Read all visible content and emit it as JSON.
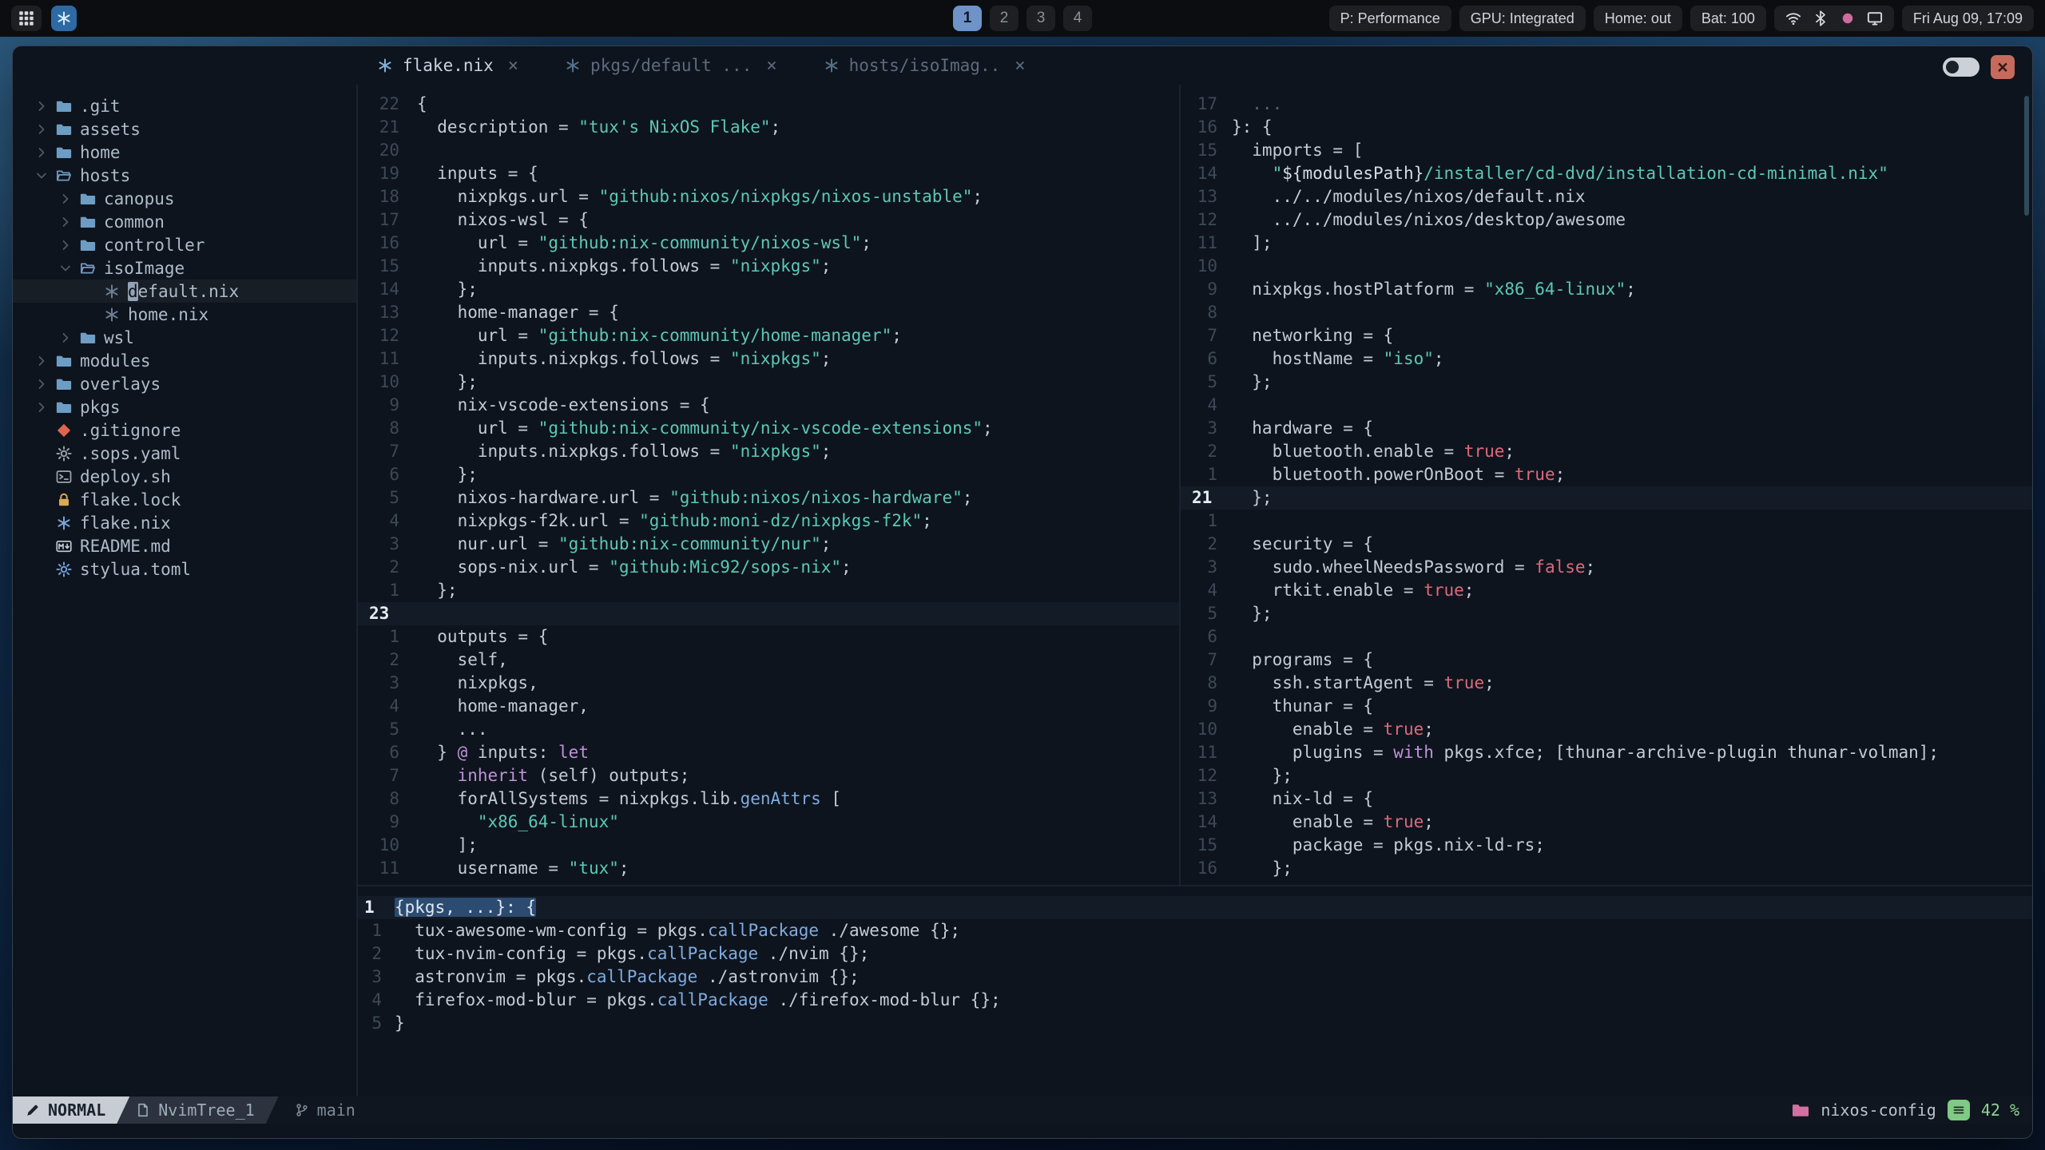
{
  "topbar": {
    "workspaces": [
      "1",
      "2",
      "3",
      "4"
    ],
    "active_workspace": "1",
    "status_chips": [
      "P: Performance",
      "GPU: Integrated",
      "Home: out",
      "Bat: 100"
    ],
    "tray_icons": [
      {
        "icon": "wifi-icon",
        "color": "#d6d9de"
      },
      {
        "icon": "bluetooth-icon",
        "color": "#d6d9de"
      },
      {
        "icon": "record-icon",
        "color": "#d06ba0"
      },
      {
        "icon": "display-icon",
        "color": "#d6d9de"
      }
    ],
    "clock": "Fri Aug 09, 17:09"
  },
  "window": {
    "tab_close_glyph": "×",
    "close_glyph": "×",
    "tabs": [
      {
        "label": "flake.nix",
        "active": true
      },
      {
        "label": "pkgs/default ...",
        "active": false
      },
      {
        "label": "hosts/isoImag..",
        "active": false
      }
    ]
  },
  "filetree": {
    "items": [
      {
        "depth": 0,
        "chevron": "right",
        "icon": "folder-icon",
        "color": "#6d9dc5",
        "label": ".git"
      },
      {
        "depth": 0,
        "chevron": "right",
        "icon": "folder-icon",
        "color": "#6d9dc5",
        "label": "assets"
      },
      {
        "depth": 0,
        "chevron": "right",
        "icon": "folder-icon",
        "color": "#6d9dc5",
        "label": "home"
      },
      {
        "depth": 0,
        "chevron": "down",
        "icon": "folder-open-icon",
        "color": "#6d9dc5",
        "label": "hosts"
      },
      {
        "depth": 1,
        "chevron": "right",
        "icon": "folder-icon",
        "color": "#6d9dc5",
        "label": "canopus"
      },
      {
        "depth": 1,
        "chevron": "right",
        "icon": "folder-icon",
        "color": "#6d9dc5",
        "label": "common"
      },
      {
        "depth": 1,
        "chevron": "right",
        "icon": "folder-icon",
        "color": "#6d9dc5",
        "label": "controller"
      },
      {
        "depth": 1,
        "chevron": "down",
        "icon": "folder-open-icon",
        "color": "#6d9dc5",
        "label": "isoImage"
      },
      {
        "depth": 2,
        "icon": "nix-icon",
        "color": "#6b7d92",
        "label": "default.nix",
        "cursor": true
      },
      {
        "depth": 2,
        "icon": "nix-icon",
        "color": "#6b7d92",
        "label": "home.nix"
      },
      {
        "depth": 1,
        "chevron": "right",
        "icon": "folder-icon",
        "color": "#6d9dc5",
        "label": "wsl"
      },
      {
        "depth": 0,
        "chevron": "right",
        "icon": "folder-icon",
        "color": "#6d9dc5",
        "label": "modules"
      },
      {
        "depth": 0,
        "chevron": "right",
        "icon": "folder-icon",
        "color": "#6d9dc5",
        "label": "overlays"
      },
      {
        "depth": 0,
        "chevron": "right",
        "icon": "folder-icon",
        "color": "#6d9dc5",
        "label": "pkgs"
      },
      {
        "depth": 0,
        "icon": "git-icon",
        "color": "#e0654f",
        "label": ".gitignore"
      },
      {
        "depth": 0,
        "icon": "gear-icon",
        "color": "#96a0ab",
        "label": ".sops.yaml"
      },
      {
        "depth": 0,
        "icon": "terminal-icon",
        "color": "#9aa5af",
        "label": "deploy.sh"
      },
      {
        "depth": 0,
        "icon": "lock-icon",
        "color": "#d9a954",
        "label": "flake.lock"
      },
      {
        "depth": 0,
        "icon": "nix-icon",
        "color": "#7aa7d4",
        "label": "flake.nix"
      },
      {
        "depth": 0,
        "icon": "markdown-icon",
        "color": "#c6cdd6",
        "label": "README.md"
      },
      {
        "depth": 0,
        "icon": "gear-icon",
        "color": "#6f9fd8",
        "label": "stylua.toml"
      }
    ]
  },
  "editors": {
    "flake": {
      "lines": [
        {
          "n": "22",
          "t": [
            [
              "p",
              "{"
            ]
          ]
        },
        {
          "n": "21",
          "t": [
            [
              "p",
              "  description = "
            ],
            [
              "s",
              "\"tux's NixOS Flake\""
            ],
            [
              "p",
              ";"
            ]
          ]
        },
        {
          "n": "20",
          "t": []
        },
        {
          "n": "19",
          "t": [
            [
              "p",
              "  inputs = {"
            ]
          ]
        },
        {
          "n": "18",
          "t": [
            [
              "p",
              "    nixpkgs.url = "
            ],
            [
              "s",
              "\"github:nixos/nixpkgs/nixos-unstable\""
            ],
            [
              "p",
              ";"
            ]
          ]
        },
        {
          "n": "17",
          "t": [
            [
              "p",
              "    nixos-wsl = {"
            ]
          ]
        },
        {
          "n": "16",
          "t": [
            [
              "p",
              "      url = "
            ],
            [
              "s",
              "\"github:nix-community/nixos-wsl\""
            ],
            [
              "p",
              ";"
            ]
          ]
        },
        {
          "n": "15",
          "t": [
            [
              "p",
              "      inputs.nixpkgs.follows = "
            ],
            [
              "s",
              "\"nixpkgs\""
            ],
            [
              "p",
              ";"
            ]
          ]
        },
        {
          "n": "14",
          "t": [
            [
              "p",
              "    };"
            ]
          ]
        },
        {
          "n": "13",
          "t": [
            [
              "p",
              "    home-manager = {"
            ]
          ]
        },
        {
          "n": "12",
          "t": [
            [
              "p",
              "      url = "
            ],
            [
              "s",
              "\"github:nix-community/home-manager\""
            ],
            [
              "p",
              ";"
            ]
          ]
        },
        {
          "n": "11",
          "t": [
            [
              "p",
              "      inputs.nixpkgs.follows = "
            ],
            [
              "s",
              "\"nixpkgs\""
            ],
            [
              "p",
              ";"
            ]
          ]
        },
        {
          "n": "10",
          "t": [
            [
              "p",
              "    };"
            ]
          ]
        },
        {
          "n": "9",
          "t": [
            [
              "p",
              "    nix-vscode-extensions = {"
            ]
          ]
        },
        {
          "n": "8",
          "t": [
            [
              "p",
              "      url = "
            ],
            [
              "s",
              "\"github:nix-community/nix-vscode-extensions\""
            ],
            [
              "p",
              ";"
            ]
          ]
        },
        {
          "n": "7",
          "t": [
            [
              "p",
              "      inputs.nixpkgs.follows = "
            ],
            [
              "s",
              "\"nixpkgs\""
            ],
            [
              "p",
              ";"
            ]
          ]
        },
        {
          "n": "6",
          "t": [
            [
              "p",
              "    };"
            ]
          ]
        },
        {
          "n": "5",
          "t": [
            [
              "p",
              "    nixos-hardware.url = "
            ],
            [
              "s",
              "\"github:nixos/nixos-hardware\""
            ],
            [
              "p",
              ";"
            ]
          ]
        },
        {
          "n": "4",
          "t": [
            [
              "p",
              "    nixpkgs-f2k.url = "
            ],
            [
              "s",
              "\"github:moni-dz/nixpkgs-f2k\""
            ],
            [
              "p",
              ";"
            ]
          ]
        },
        {
          "n": "3",
          "t": [
            [
              "p",
              "    nur.url = "
            ],
            [
              "s",
              "\"github:nix-community/nur\""
            ],
            [
              "p",
              ";"
            ]
          ]
        },
        {
          "n": "2",
          "t": [
            [
              "p",
              "    sops-nix.url = "
            ],
            [
              "s",
              "\"github:Mic92/sops-nix\""
            ],
            [
              "p",
              ";"
            ]
          ]
        },
        {
          "n": "1",
          "t": [
            [
              "p",
              "  };"
            ]
          ]
        },
        {
          "n": "23",
          "c": true,
          "t": []
        },
        {
          "n": "1",
          "t": [
            [
              "p",
              "  outputs = {"
            ]
          ]
        },
        {
          "n": "2",
          "t": [
            [
              "p",
              "    self,"
            ]
          ]
        },
        {
          "n": "3",
          "t": [
            [
              "p",
              "    nixpkgs,"
            ]
          ]
        },
        {
          "n": "4",
          "t": [
            [
              "p",
              "    home-manager,"
            ]
          ]
        },
        {
          "n": "5",
          "t": [
            [
              "p",
              "    ..."
            ]
          ]
        },
        {
          "n": "6",
          "t": [
            [
              "p",
              "  } "
            ],
            [
              "k",
              "@"
            ],
            [
              "p",
              " inputs: "
            ],
            [
              "k",
              "let"
            ]
          ]
        },
        {
          "n": "7",
          "t": [
            [
              "p",
              "    "
            ],
            [
              "k",
              "inherit"
            ],
            [
              "p",
              " (self) outputs;"
            ]
          ]
        },
        {
          "n": "8",
          "t": [
            [
              "p",
              "    forAllSystems = nixpkgs.lib."
            ],
            [
              "f",
              "genAttrs"
            ],
            [
              "p",
              " ["
            ]
          ]
        },
        {
          "n": "9",
          "t": [
            [
              "p",
              "      "
            ],
            [
              "s",
              "\"x86_64-linux\""
            ]
          ]
        },
        {
          "n": "10",
          "t": [
            [
              "p",
              "    ];"
            ]
          ]
        },
        {
          "n": "11",
          "t": [
            [
              "p",
              "    username = "
            ],
            [
              "s",
              "\"tux\""
            ],
            [
              "p",
              ";"
            ]
          ]
        }
      ]
    },
    "iso": {
      "lines": [
        {
          "n": "17",
          "t": [
            [
              "d",
              "  ..."
            ]
          ]
        },
        {
          "n": "16",
          "t": [
            [
              "p",
              "}: {"
            ]
          ]
        },
        {
          "n": "15",
          "t": [
            [
              "p",
              "  imports = ["
            ]
          ]
        },
        {
          "n": "14",
          "t": [
            [
              "p",
              "    "
            ],
            [
              "s",
              "\""
            ],
            [
              "i",
              "${modulesPath}"
            ],
            [
              "s",
              "/installer/cd-dvd/installation-cd-minimal.nix\""
            ]
          ]
        },
        {
          "n": "13",
          "t": [
            [
              "p",
              "    ../../modules/nixos/default.nix"
            ]
          ]
        },
        {
          "n": "12",
          "t": [
            [
              "p",
              "    ../../modules/nixos/desktop/awesome"
            ]
          ]
        },
        {
          "n": "11",
          "t": [
            [
              "p",
              "  ];"
            ]
          ]
        },
        {
          "n": "10",
          "t": []
        },
        {
          "n": "9",
          "t": [
            [
              "p",
              "  nixpkgs.hostPlatform = "
            ],
            [
              "s",
              "\"x86_64-linux\""
            ],
            [
              "p",
              ";"
            ]
          ]
        },
        {
          "n": "8",
          "t": []
        },
        {
          "n": "7",
          "t": [
            [
              "p",
              "  networking = {"
            ]
          ]
        },
        {
          "n": "6",
          "t": [
            [
              "p",
              "    hostName = "
            ],
            [
              "s",
              "\"iso\""
            ],
            [
              "p",
              ";"
            ]
          ]
        },
        {
          "n": "5",
          "t": [
            [
              "p",
              "  };"
            ]
          ]
        },
        {
          "n": "4",
          "t": []
        },
        {
          "n": "3",
          "t": [
            [
              "p",
              "  hardware = {"
            ]
          ]
        },
        {
          "n": "2",
          "t": [
            [
              "p",
              "    bluetooth.enable = "
            ],
            [
              "b",
              "true"
            ],
            [
              "p",
              ";"
            ]
          ]
        },
        {
          "n": "1",
          "t": [
            [
              "p",
              "    bluetooth.powerOnBoot = "
            ],
            [
              "b",
              "true"
            ],
            [
              "p",
              ";"
            ]
          ]
        },
        {
          "n": "21",
          "c": true,
          "t": [
            [
              "p",
              "  };"
            ]
          ]
        },
        {
          "n": "1",
          "t": []
        },
        {
          "n": "2",
          "t": [
            [
              "p",
              "  security = {"
            ]
          ]
        },
        {
          "n": "3",
          "t": [
            [
              "p",
              "    sudo.wheelNeedsPassword = "
            ],
            [
              "b",
              "false"
            ],
            [
              "p",
              ";"
            ]
          ]
        },
        {
          "n": "4",
          "t": [
            [
              "p",
              "    rtkit.enable = "
            ],
            [
              "b",
              "true"
            ],
            [
              "p",
              ";"
            ]
          ]
        },
        {
          "n": "5",
          "t": [
            [
              "p",
              "  };"
            ]
          ]
        },
        {
          "n": "6",
          "t": []
        },
        {
          "n": "7",
          "t": [
            [
              "p",
              "  programs = {"
            ]
          ]
        },
        {
          "n": "8",
          "t": [
            [
              "p",
              "    ssh.startAgent = "
            ],
            [
              "b",
              "true"
            ],
            [
              "p",
              ";"
            ]
          ]
        },
        {
          "n": "9",
          "t": [
            [
              "p",
              "    thunar = {"
            ]
          ]
        },
        {
          "n": "10",
          "t": [
            [
              "p",
              "      enable = "
            ],
            [
              "b",
              "true"
            ],
            [
              "p",
              ";"
            ]
          ]
        },
        {
          "n": "11",
          "t": [
            [
              "p",
              "      plugins = "
            ],
            [
              "k",
              "with"
            ],
            [
              "p",
              " pkgs.xfce; [thunar-archive-plugin thunar-volman];"
            ]
          ]
        },
        {
          "n": "12",
          "t": [
            [
              "p",
              "    };"
            ]
          ]
        },
        {
          "n": "13",
          "t": [
            [
              "p",
              "    nix-ld = {"
            ]
          ]
        },
        {
          "n": "14",
          "t": [
            [
              "p",
              "      enable = "
            ],
            [
              "b",
              "true"
            ],
            [
              "p",
              ";"
            ]
          ]
        },
        {
          "n": "15",
          "t": [
            [
              "p",
              "      package = pkgs.nix-ld-rs;"
            ]
          ]
        },
        {
          "n": "16",
          "t": [
            [
              "p",
              "    };"
            ]
          ]
        }
      ]
    },
    "pkgs": {
      "lines": [
        {
          "n": "1",
          "c": true,
          "t": [
            [
              "h",
              "{pkgs, ...}: {"
            ]
          ]
        },
        {
          "n": "1",
          "t": [
            [
              "p",
              "  tux-awesome-wm-config = pkgs."
            ],
            [
              "f",
              "callPackage"
            ],
            [
              "p",
              " ./awesome {};"
            ]
          ]
        },
        {
          "n": "2",
          "t": [
            [
              "p",
              "  tux-nvim-config = pkgs."
            ],
            [
              "f",
              "callPackage"
            ],
            [
              "p",
              " ./nvim {};"
            ]
          ]
        },
        {
          "n": "3",
          "t": [
            [
              "p",
              "  astronvim = pkgs."
            ],
            [
              "f",
              "callPackage"
            ],
            [
              "p",
              " ./astronvim {};"
            ]
          ]
        },
        {
          "n": "4",
          "t": [
            [
              "p",
              "  firefox-mod-blur = pkgs."
            ],
            [
              "f",
              "callPackage"
            ],
            [
              "p",
              " ./firefox-mod-blur {};"
            ]
          ]
        },
        {
          "n": "5",
          "t": [
            [
              "p",
              "}"
            ]
          ]
        }
      ]
    }
  },
  "statusline": {
    "mode": "NORMAL",
    "buffer": "NvimTree_1",
    "branch": "main",
    "project": "nixos-config",
    "scroll": "42 %"
  }
}
